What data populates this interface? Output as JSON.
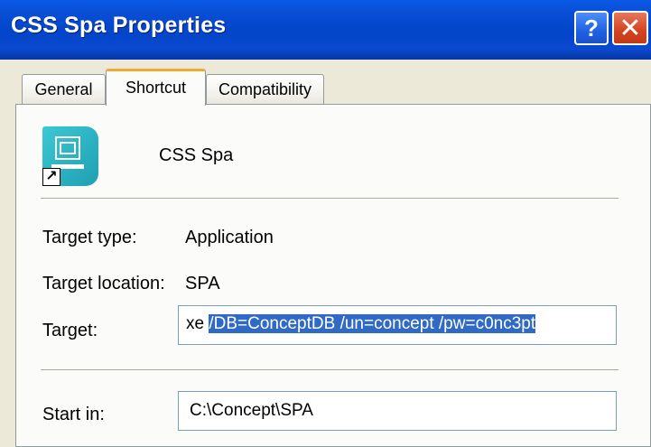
{
  "window": {
    "title": "CSS Spa Properties",
    "help_label": "?",
    "close_label": "✕"
  },
  "tabs": [
    {
      "label": "General"
    },
    {
      "label": "Shortcut"
    },
    {
      "label": "Compatibility"
    }
  ],
  "shortcut": {
    "name": "CSS Spa",
    "icon": "app-shortcut-icon",
    "target_type_label": "Target type:",
    "target_type_value": "Application",
    "target_location_label": "Target location:",
    "target_location_value": "SPA",
    "target_label": "Target:",
    "target_value_prefix": "xe ",
    "target_value_selected": "/DB=ConceptDB /un=concept /pw=c0nc3pt",
    "start_in_label": "Start in:",
    "start_in_value": "C:\\Concept\\SPA"
  },
  "colors": {
    "title_bar": "#0245c9",
    "active_tab_accent": "#f3a830",
    "selection": "#316ac5",
    "dialog_bg": "#ece9d8"
  }
}
